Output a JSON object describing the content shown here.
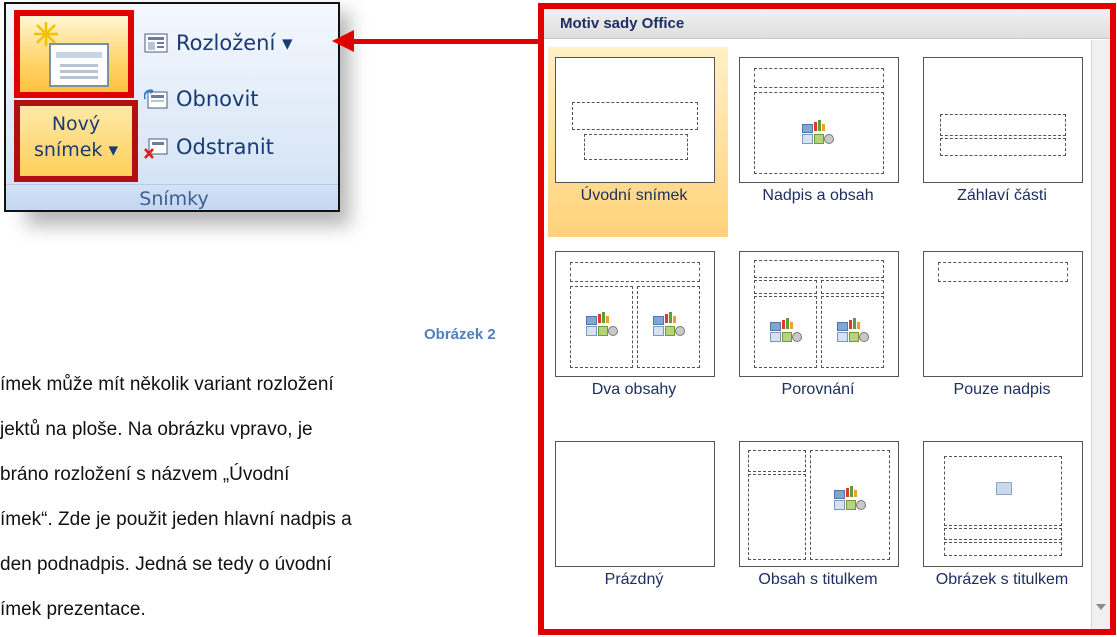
{
  "ribbon": {
    "new_slide_line1": "Nový",
    "new_slide_line2": "snímek ▾",
    "layout_label": "Rozložení ▾",
    "reset_label": "Obnovit",
    "delete_label": "Odstranit",
    "group_label": "Snímky"
  },
  "caption": "Obrázek 2",
  "paragraph": [
    "ímek může mít několik variant rozložení",
    "jektů na ploše. Na obrázku vpravo, je",
    "bráno      rozložení      s názvem      „Úvodní",
    "ímek“. Zde je použit jeden hlavní nadpis a",
    "den podnadpis. Jedná se tedy o úvodní",
    "ímek prezentace."
  ],
  "gallery": {
    "title": "Motiv sady Office",
    "selected": "Úvodní snímek",
    "layouts": [
      {
        "label": "Úvodní snímek"
      },
      {
        "label": "Nadpis a obsah"
      },
      {
        "label": "Záhlaví části"
      },
      {
        "label": "Dva obsahy"
      },
      {
        "label": "Porovnání"
      },
      {
        "label": "Pouze nadpis"
      },
      {
        "label": "Prázdný"
      },
      {
        "label": "Obsah s titulkem"
      },
      {
        "label": "Obrázek s titulkem"
      }
    ]
  },
  "colors": {
    "highlight_border": "#e00000",
    "caption": "#4f81bd",
    "selected_tile": "#ffd27a"
  }
}
